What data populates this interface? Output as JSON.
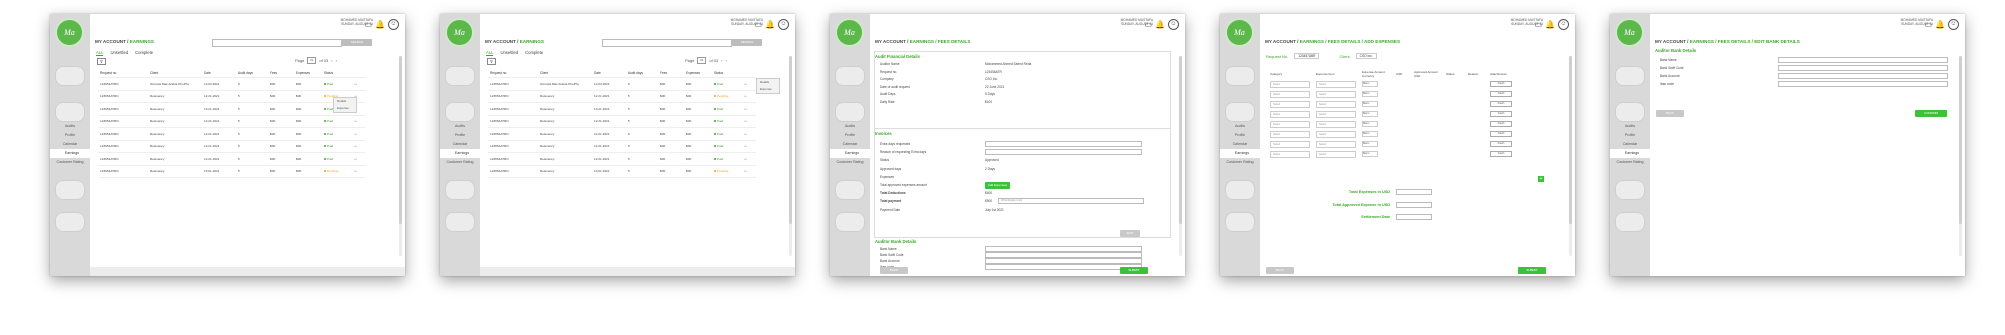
{
  "user": {
    "name": "MOHAMED MUSTAFA",
    "date": "SUNDAY, AUGUST 21"
  },
  "sidebar": {
    "links": [
      "Audits",
      "Profile",
      "Calendar",
      "Earnings",
      "Customer Rating"
    ],
    "active": "Earnings"
  },
  "breadcrumb": {
    "base": "MY ACCOUNT / ",
    "s1": "EARNINGS",
    "s2": "EARNINGS / FEES DETAILS",
    "s4": "EARNINGS / FEES DETAILS / ADD EXPENSES",
    "s5": "EARNINGS / FEES DETAILS / EDIT BANK DETAILS"
  },
  "tabs": [
    "ALL",
    "Unsettled",
    "Complete"
  ],
  "search_label": "SEARCH",
  "pager": {
    "label": "Page",
    "page": "01",
    "of": "of 03"
  },
  "table": {
    "headers": [
      "Request no.",
      "Client",
      "Date",
      "Audit days",
      "Fees",
      "Expenses",
      "Status"
    ],
    "rows": [
      [
        "123654ATRN",
        "Simsola Mas Arabia PhoPhy",
        "12.03.2021",
        "5",
        "$00",
        "$00",
        "Paid"
      ],
      [
        "123654ATRN",
        "Relevancy",
        "12.21.2021",
        "5",
        "$00",
        "$00",
        "Pending"
      ],
      [
        "123654ATRN",
        "Relevancy",
        "13.21.2021",
        "5",
        "$00",
        "$00",
        "Paid"
      ],
      [
        "123654ATRN",
        "Relevancy",
        "12.21.2021",
        "5",
        "$00",
        "$00",
        "Paid"
      ],
      [
        "123654ATRN",
        "Relevancy",
        "12.21.2021",
        "5",
        "$00",
        "$00",
        "Paid"
      ],
      [
        "123654ATRN",
        "Relevancy",
        "12.21.2021",
        "5",
        "$00",
        "$00",
        "Paid"
      ],
      [
        "123654ATRN",
        "Relevancy",
        "12.21.2021",
        "5",
        "$00",
        "$00",
        "Paid"
      ],
      [
        "123654ATRN",
        "Relevancy",
        "13.01.2021",
        "5",
        "$00",
        "$00",
        "Pending"
      ]
    ]
  },
  "popup": [
    "Details",
    "Expense"
  ],
  "fees": {
    "title": "Audit Financial Details",
    "rows": [
      [
        "Auditor Name",
        "Mohammed Ahmed Saeed Reda"
      ],
      [
        "Request no.",
        "123456ATR"
      ],
      [
        "Company",
        "CSO Inc."
      ],
      [
        "Date of audit request",
        "22 June 2021"
      ],
      [
        "Audit Days",
        "5 Days"
      ],
      [
        "Daily Rate",
        "$100"
      ]
    ],
    "invoice_title": "Invoices",
    "inv_rows": [
      [
        "Extra days requested",
        ""
      ],
      [
        "Reason of requesting Extra days",
        ""
      ],
      [
        "Status",
        "Approved"
      ],
      [
        "Approved days",
        "2 Days"
      ],
      [
        "Expenses",
        "Add Expenses"
      ],
      [
        "Total approved expenses amount",
        "$200"
      ],
      [
        "Total Deductions",
        "$400"
      ],
      [
        "Total payment",
        "$900"
      ],
      [
        "Payment Date",
        "July 1st 2021"
      ]
    ],
    "deduct_placeholder": "Write/display reply",
    "edit": "EDIT",
    "bank_title": "Auditor Bank Details",
    "bank_rows": [
      "Bank Name",
      "Bank Swift Code",
      "Bank Account",
      "Iban code"
    ],
    "back": "BACK",
    "submit": "SUBMIT",
    "confirm": "CONFIRM"
  },
  "expenses": {
    "req_label": "Request No.",
    "req_val": "123457ABR",
    "client_label": "Client",
    "client_val": "CSO Inc.",
    "headers": [
      "Category",
      "Expense Item",
      "Expense Amount Currency",
      "USD",
      "Approved Amount USD",
      "Status",
      "Reason",
      "Attachments"
    ],
    "select": "Select",
    "currency": "$Euro",
    "attach": "Attach",
    "totals": [
      "Total Expenses in USD",
      "Total Approved Expense in USD",
      "Settlement Date"
    ]
  }
}
